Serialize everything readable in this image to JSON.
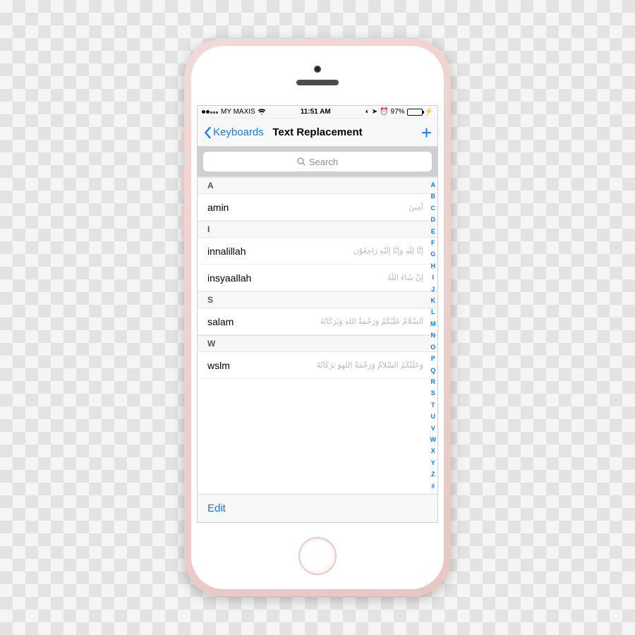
{
  "status": {
    "carrier": "MY MAXIS",
    "time": "11:51 AM",
    "battery_pct": "97%"
  },
  "nav": {
    "back_label": "Keyboards",
    "title": "Text Replacement",
    "add_label": "+"
  },
  "search": {
    "placeholder": "Search"
  },
  "sections": [
    {
      "letter": "A",
      "rows": [
        {
          "shortcut": "amin",
          "phrase": "اَمِينَ"
        }
      ]
    },
    {
      "letter": "I",
      "rows": [
        {
          "shortcut": "innalillah",
          "phrase": "إِنَّا لِلَّٰهِ وَإِنَّا إِلَيْهِ رَاجِعُوْن"
        },
        {
          "shortcut": "insyaallah",
          "phrase": "إِنْ شَاءَ اللَّهُ"
        }
      ]
    },
    {
      "letter": "S",
      "rows": [
        {
          "shortcut": "salam",
          "phrase": "اَلسَّلَامُ عَلَيْكُمْ وَرَحْمَةُ اللهِ وَبَرَكَاتُهُ"
        }
      ]
    },
    {
      "letter": "W",
      "rows": [
        {
          "shortcut": "wslm",
          "phrase": "وَعَلَيْكُمُ السَّلاَمُ وَرَحْمَةُ اللهِوَ بَرَكَاتُهُ"
        }
      ]
    }
  ],
  "toolbar": {
    "edit": "Edit"
  },
  "index_letters": [
    "A",
    "B",
    "C",
    "D",
    "E",
    "F",
    "G",
    "H",
    "I",
    "J",
    "K",
    "L",
    "M",
    "N",
    "O",
    "P",
    "Q",
    "R",
    "S",
    "T",
    "U",
    "V",
    "W",
    "X",
    "Y",
    "Z",
    "#"
  ]
}
